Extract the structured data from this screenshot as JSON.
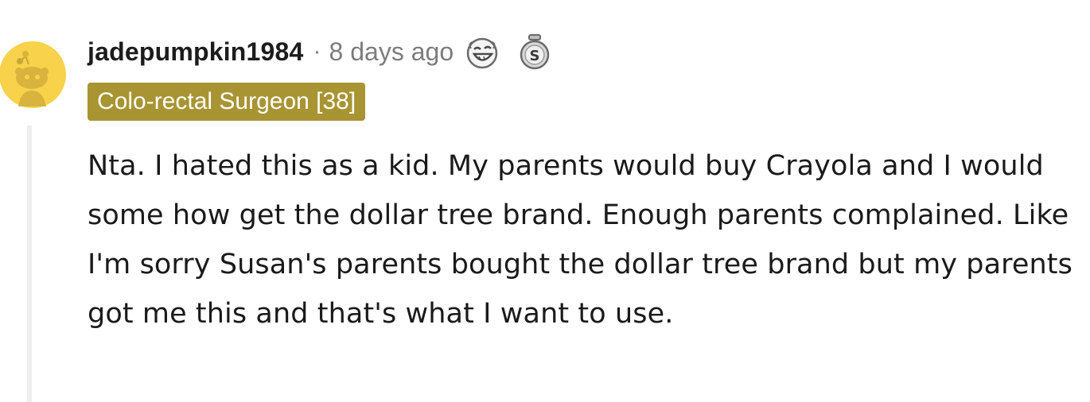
{
  "comment": {
    "username": "jadepumpkin1984",
    "separator": "·",
    "timestamp": "8 days ago",
    "flair": "Colo-rectal Surgeon [38]",
    "awards": [
      "laughing-face-award-icon",
      "silver-coin-award-icon"
    ],
    "body": "Nta. I hated this as a kid. My parents would buy Crayola and I would some how get the dollar tree brand. Enough parents complained. Like I'm sorry Susan's parents bought the dollar tree brand but my parents got me this and that's what I want to use."
  },
  "colors": {
    "flair_background": "#a89433",
    "avatar_background": "#f7d24a",
    "thread_line": "#ededed",
    "meta_text": "#7c7c7c"
  }
}
